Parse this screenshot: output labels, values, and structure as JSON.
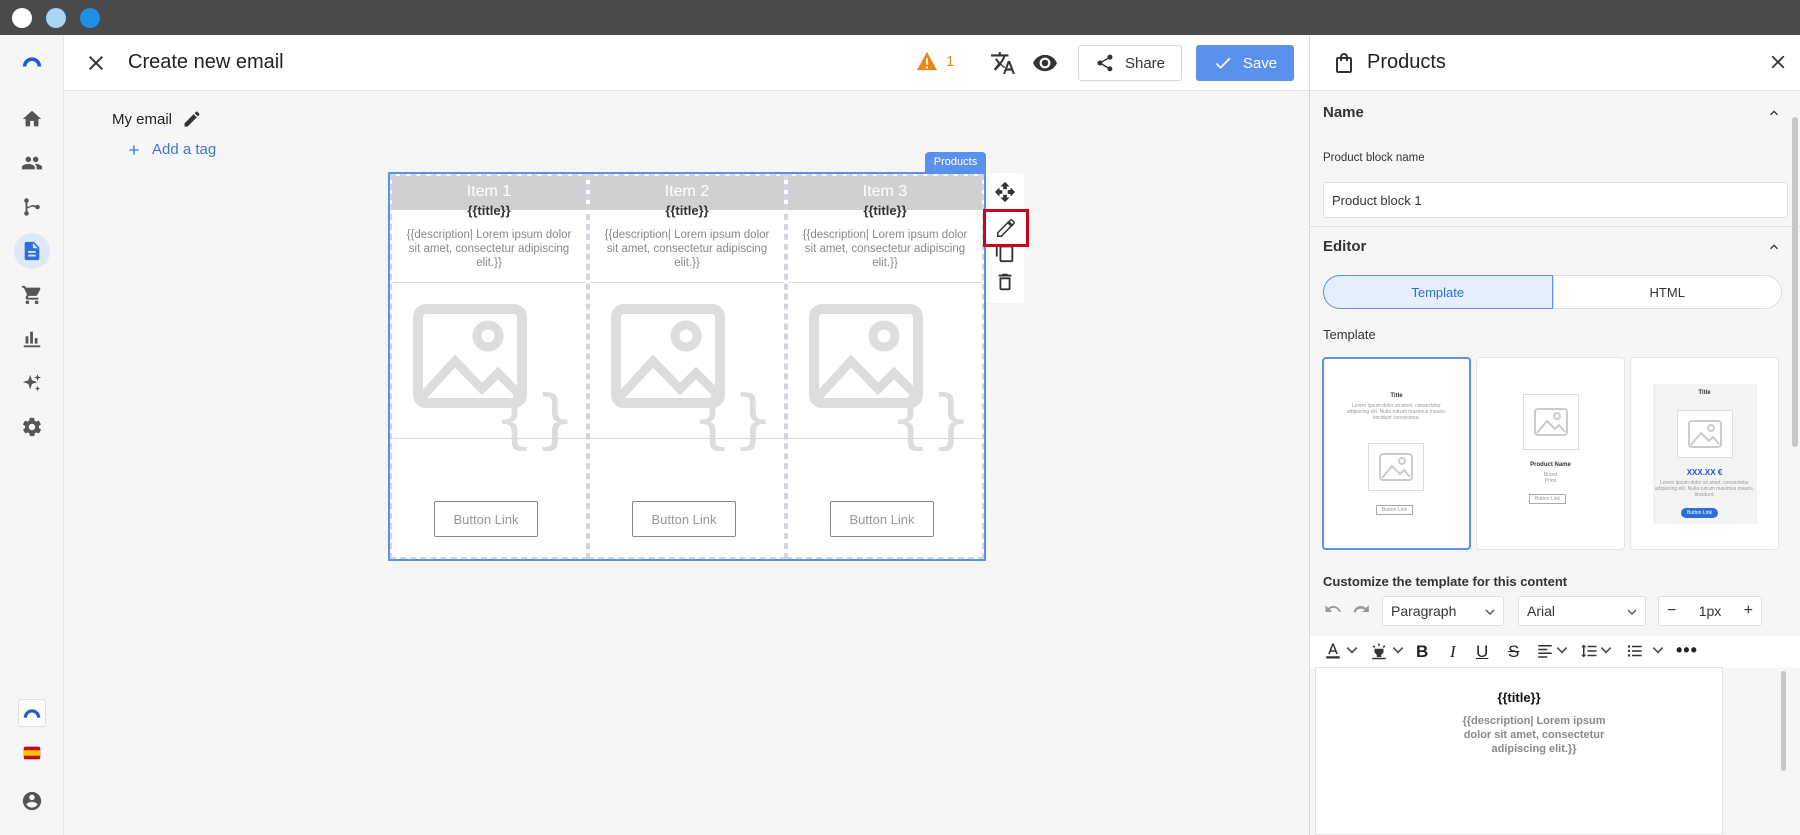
{
  "window": {
    "dots": [
      "#ffffff",
      "#a8d4f5",
      "#1e90e8"
    ]
  },
  "header": {
    "title": "Create new email",
    "warning_count": "1",
    "share_label": "Share",
    "save_label": "Save"
  },
  "canvas": {
    "email_name": "My email",
    "add_tag_label": "Add a tag",
    "block_label": "Products",
    "columns": [
      {
        "item": "Item 1",
        "title": "{{title}}",
        "description": "{{description| Lorem ipsum dolor sit amet, consectetur adipiscing elit.}}",
        "button": "Button Link"
      },
      {
        "item": "Item 2",
        "title": "{{title}}",
        "description": "{{description| Lorem ipsum dolor sit amet, consectetur adipiscing elit.}}",
        "button": "Button Link"
      },
      {
        "item": "Item 3",
        "title": "{{title}}",
        "description": "{{description| Lorem ipsum dolor sit amet, consectetur adipiscing elit.}}",
        "button": "Button Link"
      }
    ]
  },
  "panel": {
    "title": "Products",
    "name_section": "Name",
    "block_name_label": "Product block name",
    "block_name_value": "Product block 1",
    "editor_section": "Editor",
    "tab_template": "Template",
    "tab_html": "HTML",
    "template_label": "Template",
    "templates": [
      {
        "title": "Title",
        "lorem": "Lorem ipsum dolor sit amet, consectetur adipiscing elit. Nulla rutrum maximus mauris, tincidunt consectetur.",
        "button": "Button Link"
      },
      {
        "product_name": "Product Name",
        "brand": "Brand",
        "price": "Price",
        "button": "Button Link"
      },
      {
        "title": "Title",
        "price": "XXX.XX €",
        "lorem": "Lorem ipsum dolor sit amet, consectetur adipiscing elit. Nulla rutrum maximus mauris, tincidunt.",
        "button": "Button Link"
      }
    ],
    "customize_label": "Customize the template for this content",
    "paragraph_select": "Paragraph",
    "font_select": "Arial",
    "size_value": "1px",
    "preview_title": "{{title}}",
    "preview_desc": "{{description| Lorem ipsum dolor sit amet, consectetur adipiscing elit.}}"
  }
}
